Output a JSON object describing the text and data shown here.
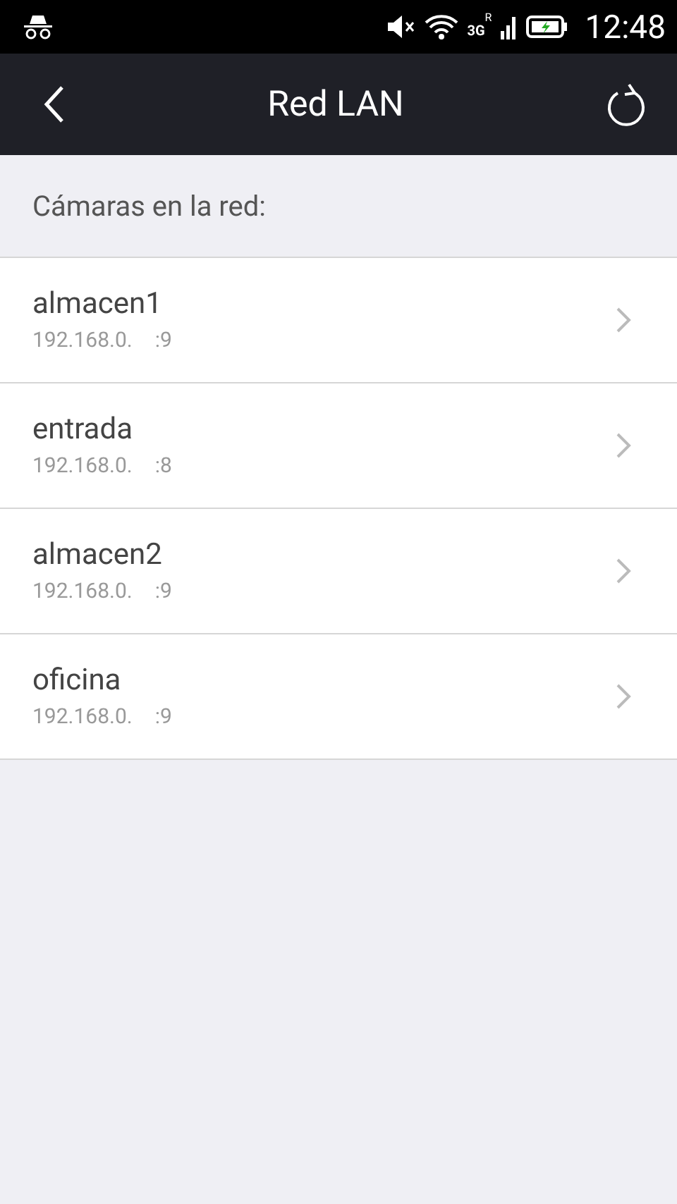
{
  "status_bar": {
    "network": "3G",
    "roaming": "R",
    "time": "12:48"
  },
  "header": {
    "title": "Red LAN"
  },
  "section": {
    "title": "Cámaras en la red:"
  },
  "cameras": [
    {
      "name": "almacen1",
      "address": "192.168.0.",
      "port": ":9"
    },
    {
      "name": "entrada",
      "address": "192.168.0.",
      "port": ":8"
    },
    {
      "name": "almacen2",
      "address": "192.168.0.",
      "port": ":9"
    },
    {
      "name": "oficina",
      "address": "192.168.0.",
      "port": ":9"
    }
  ]
}
